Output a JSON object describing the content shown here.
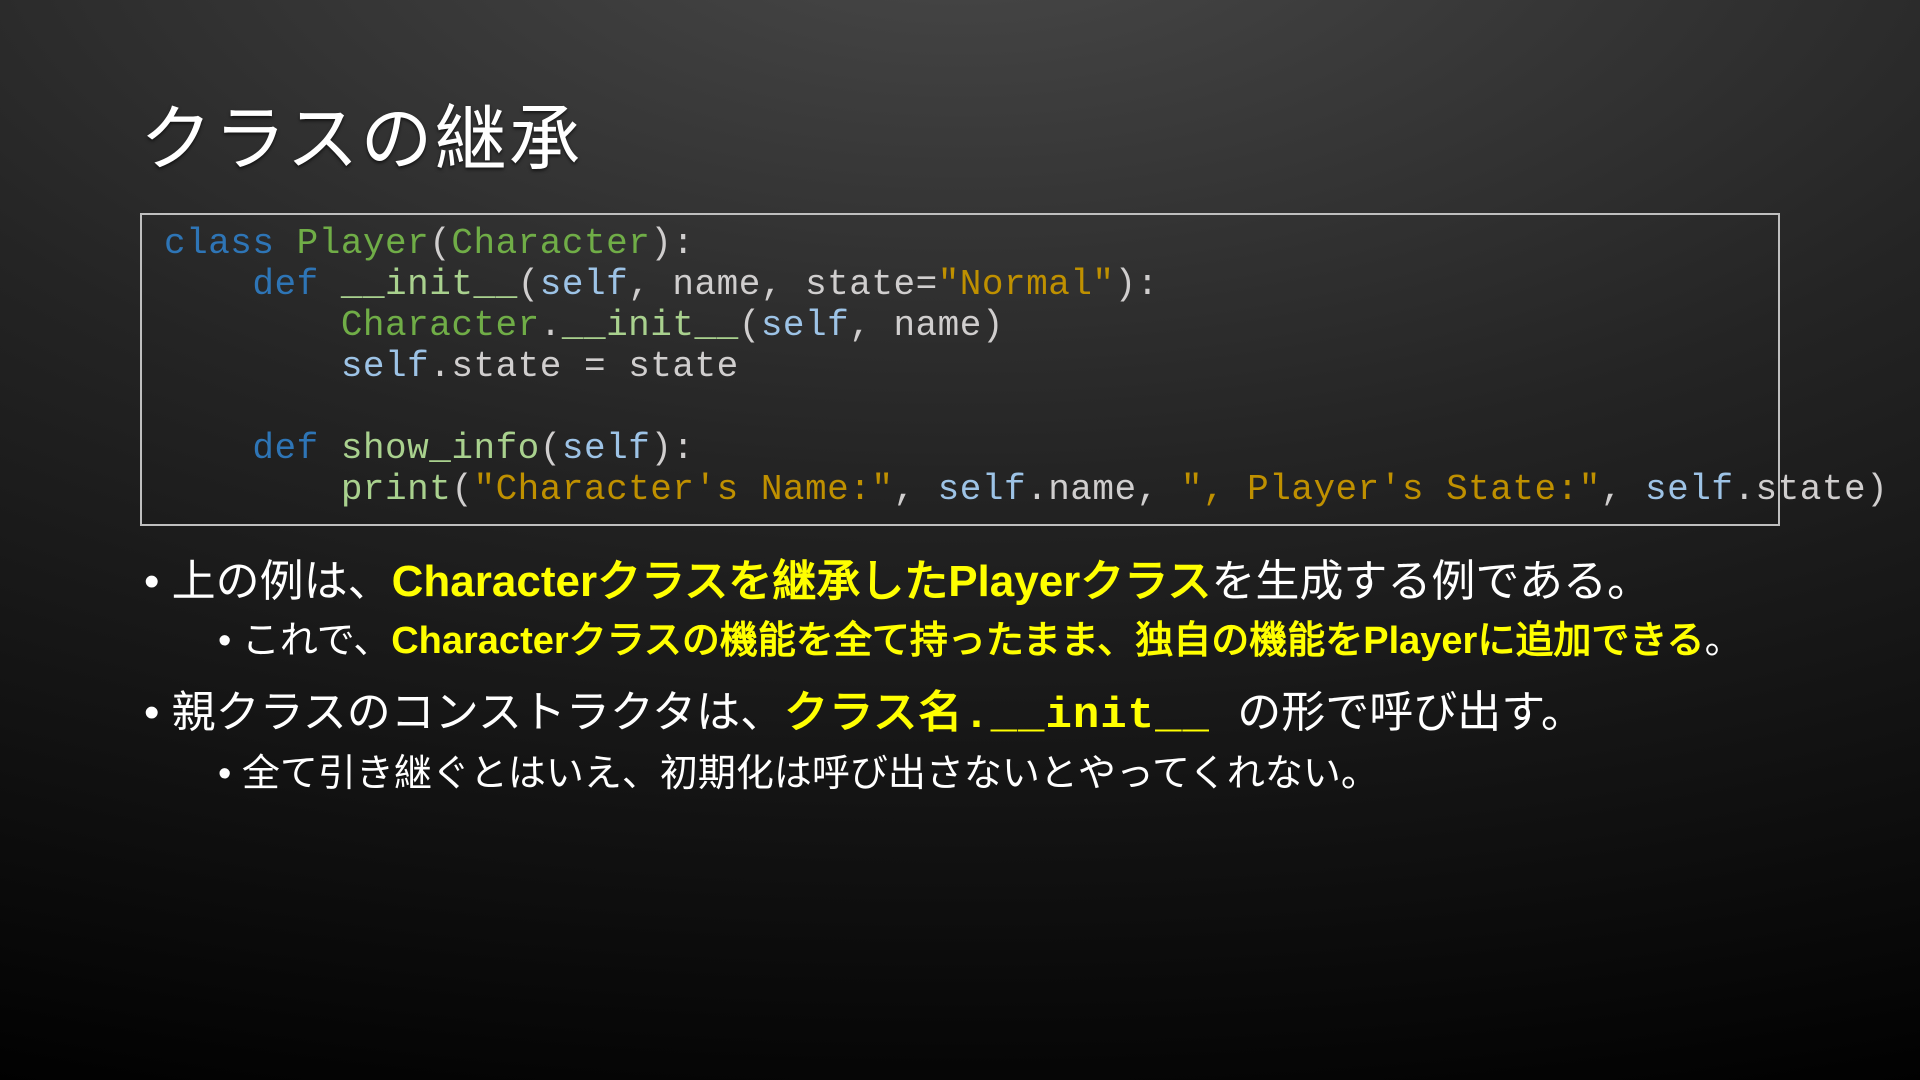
{
  "title": "クラスの継承",
  "code": {
    "l1": {
      "kw": "class ",
      "cls": "Player",
      "p1": "(",
      "base": "Character",
      "p2": "):"
    },
    "l2": {
      "pad": "    ",
      "kw": "def ",
      "fn": "__init__",
      "p1": "(",
      "self": "self",
      "c1": ", ",
      "a1": "name",
      "c2": ", ",
      "a2": "state",
      "eq": "=",
      "str": "\"Normal\"",
      "p2": "):"
    },
    "l3": {
      "pad": "        ",
      "base": "Character",
      "dot": ".",
      "fn": "__init__",
      "p1": "(",
      "self": "self",
      "c1": ", ",
      "a1": "name",
      "p2": ")"
    },
    "l4": {
      "pad": "        ",
      "self": "self",
      "dot": ".",
      "a1": "state ",
      "eq": "= ",
      "a2": "state"
    },
    "l5": "",
    "l6": {
      "pad": "    ",
      "kw": "def ",
      "fn": "show_info",
      "p1": "(",
      "self": "self",
      "p2": "):"
    },
    "l7": {
      "pad": "        ",
      "fn": "print",
      "p1": "(",
      "s1": "\"Character's Name:\"",
      "c1": ", ",
      "self1": "self",
      "d1": ".",
      "a1": "name",
      "c2": ", ",
      "s2": "\", Player's State:\"",
      "c3": ", ",
      "self2": "self",
      "d2": ".",
      "a2": "state",
      "p2": ")"
    }
  },
  "bullets": {
    "b1": {
      "pre": "上の例は、",
      "hl": "Characterクラスを継承したPlayerクラス",
      "post": "を生成する例である。"
    },
    "b1a": {
      "pre": "これで、",
      "hl": "Characterクラスの機能を全て持ったまま、独自の機能をPlayerに追加できる",
      "post": "。"
    },
    "b2": {
      "pre": "親クラスのコンストラクタは、",
      "hl": "クラス名.__init__ ",
      "post": "の形で呼び出す。"
    },
    "b2a": {
      "text": "全て引き継ぐとはいえ、初期化は呼び出さないとやってくれない。"
    }
  }
}
